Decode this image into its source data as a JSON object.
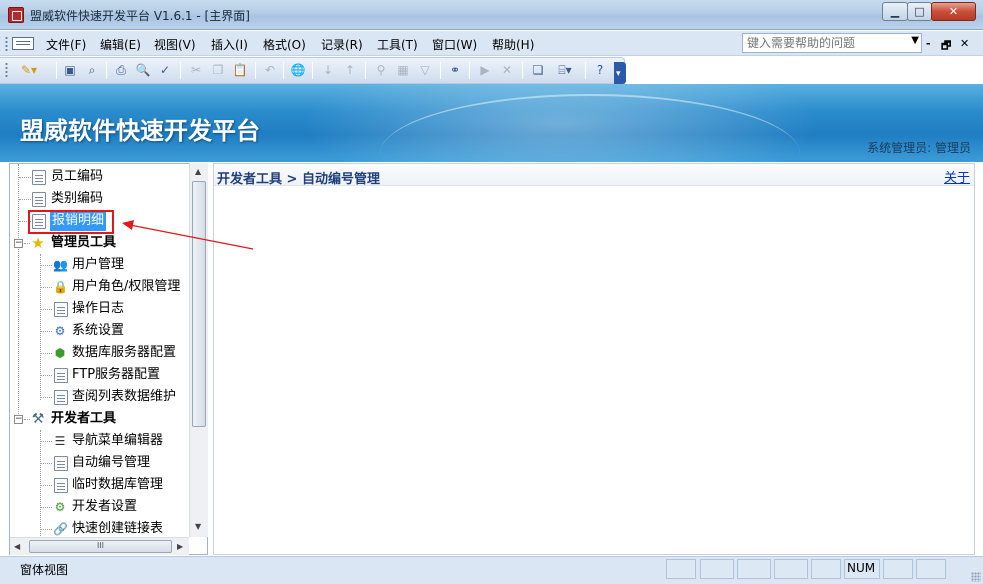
{
  "window": {
    "title": "盟威软件快速开发平台 V1.6.1 - [主界面]",
    "min_glyph": "▁",
    "max_glyph": "□",
    "close_glyph": "✕"
  },
  "menubar": {
    "items": [
      "文件(F)",
      "编辑(E)",
      "视图(V)",
      "插入(I)",
      "格式(O)",
      "记录(R)",
      "工具(T)",
      "窗口(W)",
      "帮助(H)"
    ],
    "help_placeholder": "键入需要帮助的问题",
    "mdi_min": "-",
    "mdi_restore": "🗗",
    "mdi_close": "✕"
  },
  "toolbar": {
    "icons": [
      "view-icon",
      "save-icon",
      "search-icon",
      "print-icon",
      "print-preview-icon",
      "spellcheck-icon",
      "cut-icon",
      "copy-icon",
      "paste-icon",
      "undo-icon",
      "hyperlink-icon",
      "sort-ascending-icon",
      "sort-descending-icon",
      "filter-by-selection-icon",
      "filter-by-form-icon",
      "apply-filter-icon",
      "find-icon",
      "new-record-icon",
      "delete-record-icon",
      "database-window-icon",
      "new-object-icon",
      "help-icon"
    ]
  },
  "banner": {
    "title": "盟威软件快速开发平台",
    "user": "系统管理员: 管理员"
  },
  "nav": {
    "items": [
      {
        "label": "员工编码",
        "level": 1,
        "icon": "document-icon"
      },
      {
        "label": "类别编码",
        "level": 1,
        "icon": "document-icon"
      },
      {
        "label": "报销明细",
        "level": 1,
        "icon": "document-icon",
        "selected": true
      },
      {
        "label": "管理员工具",
        "level": 0,
        "icon": "star-icon",
        "group": true
      },
      {
        "label": "用户管理",
        "level": 2,
        "icon": "users-icon"
      },
      {
        "label": "用户角色/权限管理",
        "level": 2,
        "icon": "lock-icon"
      },
      {
        "label": "操作日志",
        "level": 2,
        "icon": "document-icon"
      },
      {
        "label": "系统设置",
        "level": 2,
        "icon": "settings-icon"
      },
      {
        "label": "数据库服务器配置",
        "level": 2,
        "icon": "database-server-icon"
      },
      {
        "label": "FTP服务器配置",
        "level": 2,
        "icon": "document-icon"
      },
      {
        "label": "查阅列表数据维护",
        "level": 2,
        "icon": "document-icon"
      },
      {
        "label": "开发者工具",
        "level": 0,
        "icon": "tools-icon",
        "group": true
      },
      {
        "label": "导航菜单编辑器",
        "level": 2,
        "icon": "list-icon"
      },
      {
        "label": "自动编号管理",
        "level": 2,
        "icon": "document-icon"
      },
      {
        "label": "临时数据库管理",
        "level": 2,
        "icon": "document-icon"
      },
      {
        "label": "开发者设置",
        "level": 2,
        "icon": "settings-gear-icon"
      },
      {
        "label": "快速创建链接表",
        "level": 2,
        "icon": "link-icon"
      }
    ],
    "hscroll_thumb": "III"
  },
  "main": {
    "breadcrumb": "开发者工具 > 自动编号管理",
    "close_link": "关于"
  },
  "status": {
    "text": "窗体视图",
    "num_indicator": "NUM"
  },
  "colors": {
    "banner": "#2b8ccc",
    "selection": "#3399ff",
    "annotation": "#e0181b",
    "breadcrumb": "#1f3f79"
  }
}
